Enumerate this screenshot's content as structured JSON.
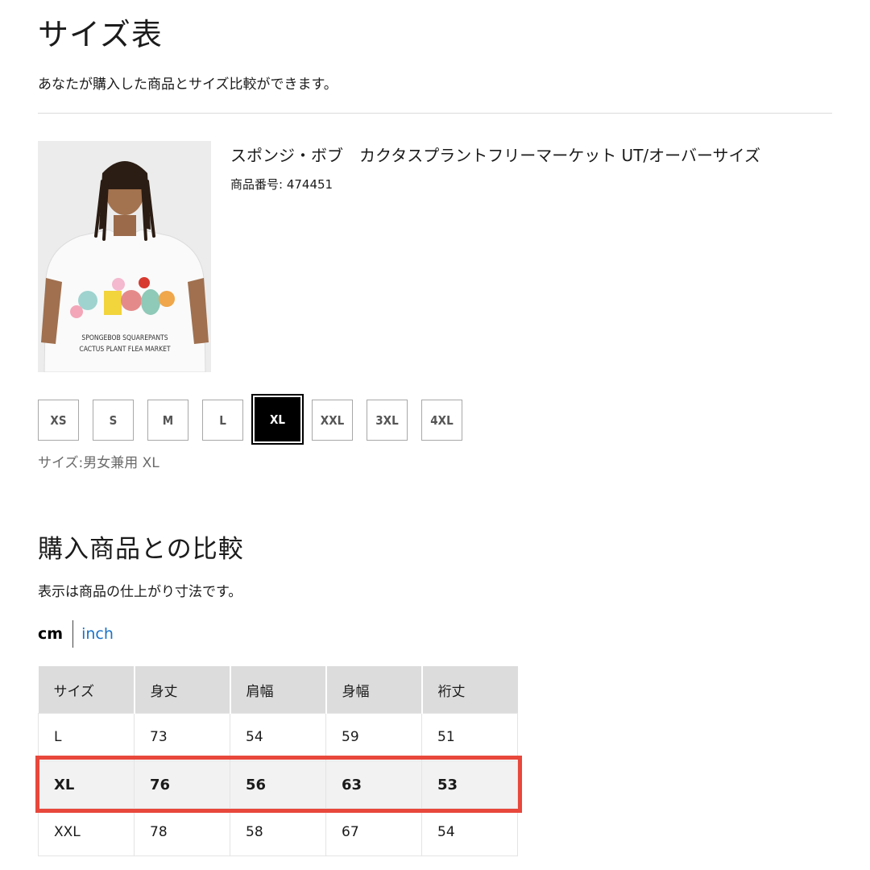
{
  "page": {
    "title": "サイズ表",
    "description": "あなたが購入した商品とサイズ比較ができます。"
  },
  "product": {
    "name": "スポンジ・ボブ　カクタスプラントフリーマーケット UT/オーバーサイズ",
    "number": "商品番号: 474451",
    "image_text_line1": "SPONGEBOB SQUAREPANTS",
    "image_text_line2": "CACTUS PLANT FLEA MARKET"
  },
  "sizes": {
    "options": [
      "XS",
      "S",
      "M",
      "L",
      "XL",
      "XXL",
      "3XL",
      "4XL"
    ],
    "selected": "XL",
    "selected_label": "サイズ:男女兼用 XL"
  },
  "comparison": {
    "title": "購入商品との比較",
    "description": "表示は商品の仕上がり寸法です。",
    "unit_cm": "cm",
    "unit_inch": "inch",
    "headers": [
      "サイズ",
      "身丈",
      "肩幅",
      "身幅",
      "裄丈"
    ],
    "rows": [
      [
        "L",
        "73",
        "54",
        "59",
        "51"
      ],
      [
        "XL",
        "76",
        "56",
        "63",
        "53"
      ],
      [
        "XXL",
        "78",
        "58",
        "67",
        "54"
      ]
    ],
    "highlighted_row": 1
  },
  "colors": {
    "highlight_border": "#e8473b",
    "link": "#1a73c8"
  }
}
